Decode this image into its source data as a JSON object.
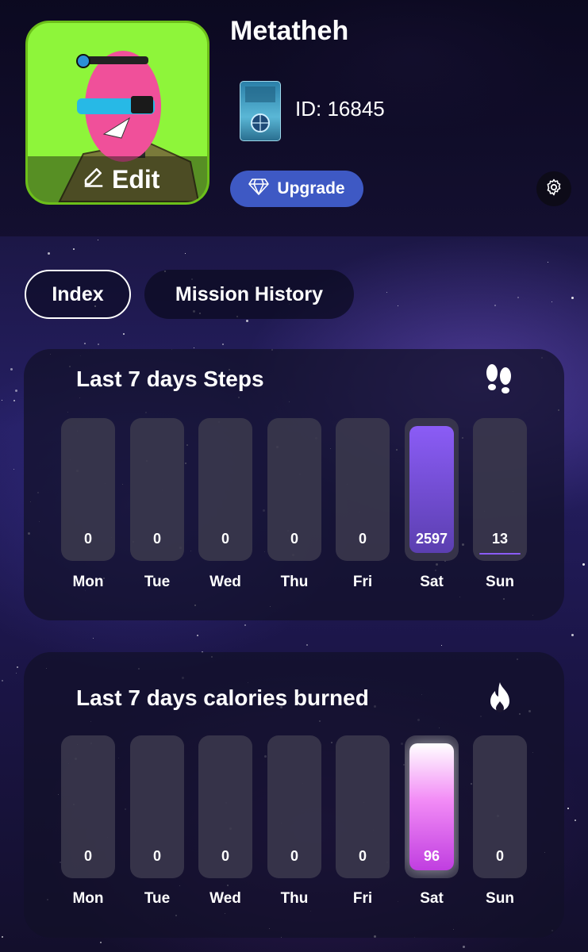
{
  "profile": {
    "username": "Metatheh",
    "edit_label": "Edit",
    "id_text": "ID: 16845",
    "upgrade_label": "Upgrade"
  },
  "tabs": [
    {
      "label": "Index",
      "active": true
    },
    {
      "label": "Mission History",
      "active": false
    }
  ],
  "steps_card": {
    "title": "Last 7 days Steps",
    "icon": "footprints-icon",
    "days": [
      {
        "day": "Mon",
        "value": "0"
      },
      {
        "day": "Tue",
        "value": "0"
      },
      {
        "day": "Wed",
        "value": "0"
      },
      {
        "day": "Thu",
        "value": "0"
      },
      {
        "day": "Fri",
        "value": "0"
      },
      {
        "day": "Sat",
        "value": "2597"
      },
      {
        "day": "Sun",
        "value": "13"
      }
    ]
  },
  "calories_card": {
    "title": "Last 7 days calories burned",
    "icon": "flame-icon",
    "days": [
      {
        "day": "Mon",
        "value": "0"
      },
      {
        "day": "Tue",
        "value": "0"
      },
      {
        "day": "Wed",
        "value": "0"
      },
      {
        "day": "Thu",
        "value": "0"
      },
      {
        "day": "Fri",
        "value": "0"
      },
      {
        "day": "Sat",
        "value": "96"
      },
      {
        "day": "Sun",
        "value": "0"
      }
    ]
  },
  "colors": {
    "avatar_bg": "#8ef53a",
    "upgrade_button": "#3e59c4",
    "steps_bar_accent": "#8b5cf6",
    "calories_bar_accent": "#e879f9"
  }
}
